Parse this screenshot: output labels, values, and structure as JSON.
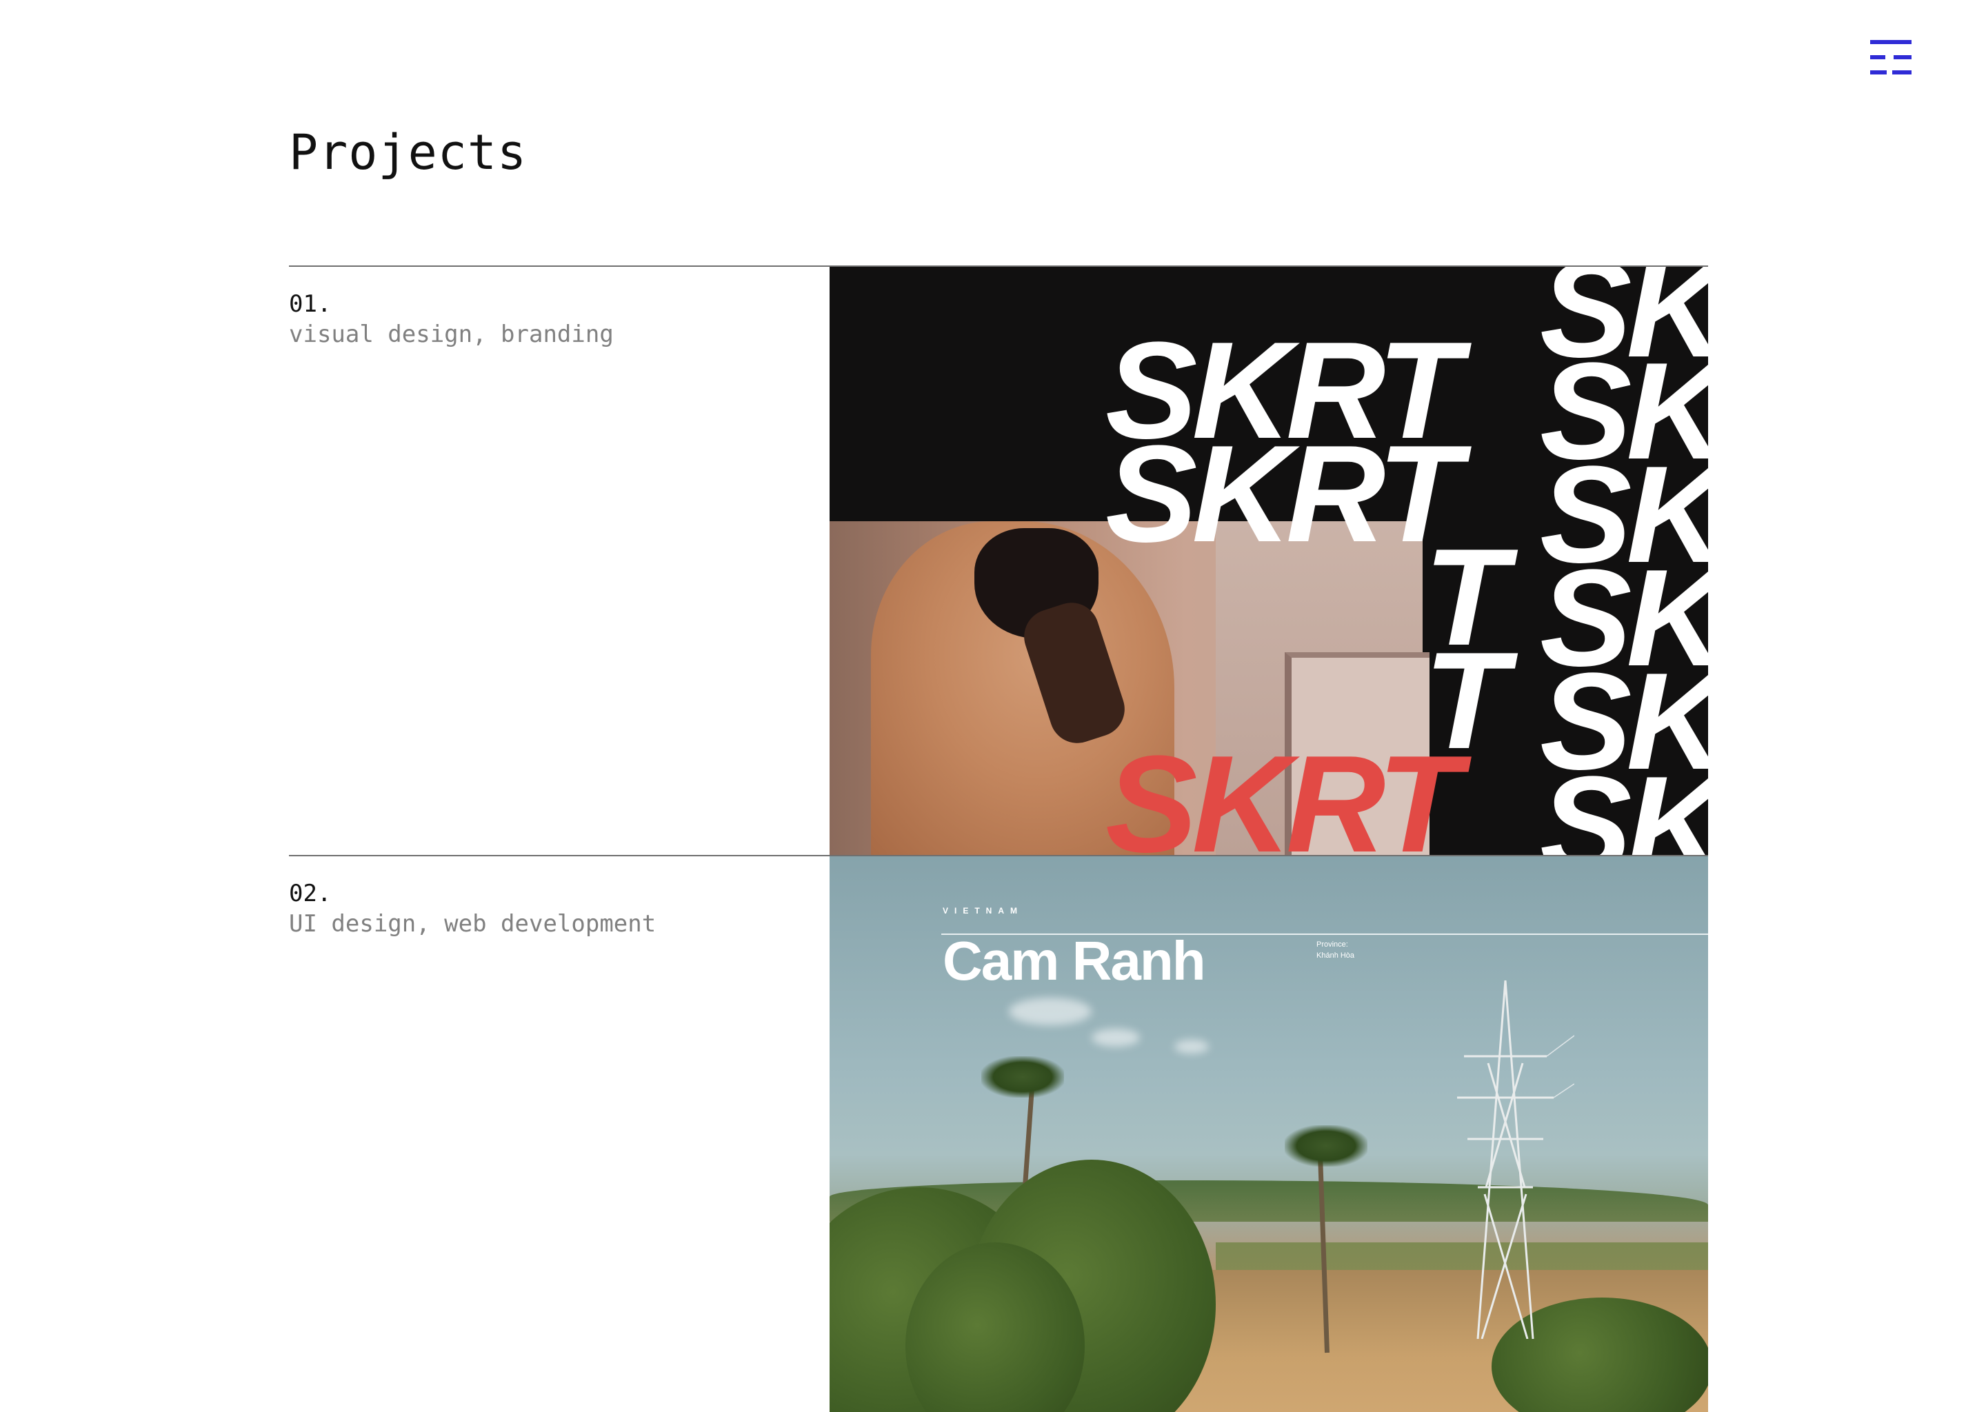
{
  "header": {
    "menu_icon": "hamburger-menu-icon",
    "accent_color": "#2f2bd6"
  },
  "page": {
    "title": "Projects"
  },
  "projects": [
    {
      "number": "01.",
      "tags": "visual design, branding",
      "thumbnail": {
        "wordmark": "SKRT",
        "wordmark_partial": "SK",
        "wordmark_tail": "T",
        "accent_color": "#e24a45"
      }
    },
    {
      "number": "02.",
      "tags": "UI design, web development",
      "thumbnail": {
        "country": "VIETNAM",
        "city": "Cam Ranh",
        "province_label": "Province:",
        "province_value": "Khánh Hòa"
      }
    }
  ]
}
